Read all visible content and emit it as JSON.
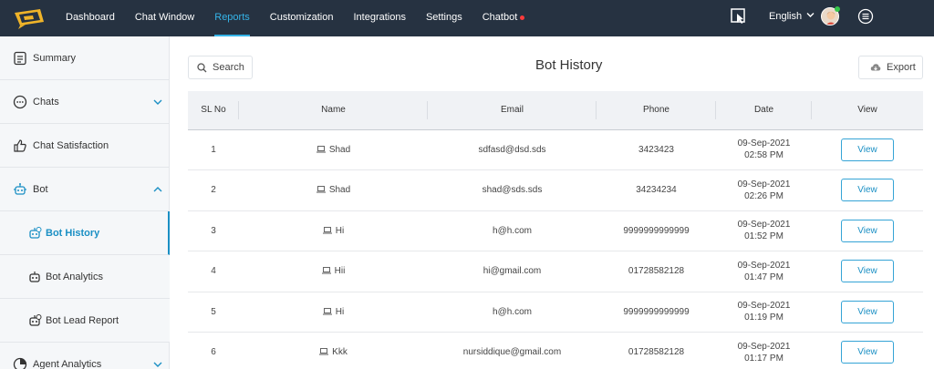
{
  "nav": {
    "items": [
      {
        "label": "Dashboard",
        "name": "nav-dashboard"
      },
      {
        "label": "Chat Window",
        "name": "nav-chat-window"
      },
      {
        "label": "Reports",
        "name": "nav-reports"
      },
      {
        "label": "Customization",
        "name": "nav-customization"
      },
      {
        "label": "Integrations",
        "name": "nav-integrations"
      },
      {
        "label": "Settings",
        "name": "nav-settings"
      },
      {
        "label": "Chatbot",
        "name": "nav-chatbot"
      }
    ],
    "active": "Reports",
    "language": "English",
    "accent_color": "#35b4e8",
    "bg_color": "#263241",
    "notification_dot_color": "#ff3b3b"
  },
  "sidebar": {
    "items": [
      {
        "label": "Summary",
        "icon": "document-icon"
      },
      {
        "label": "Chats",
        "icon": "chat-bubble-icon"
      },
      {
        "label": "Chat Satisfaction",
        "icon": "thumbs-up-icon"
      },
      {
        "label": "Bot",
        "icon": "bot-icon"
      },
      {
        "label": "Bot History",
        "icon": "bot-history-icon"
      },
      {
        "label": "Bot Analytics",
        "icon": "bot-analytics-icon"
      },
      {
        "label": "Bot Lead Report",
        "icon": "bot-lead-icon"
      },
      {
        "label": "Agent Analytics",
        "icon": "agent-analytics-icon"
      }
    ],
    "active": "Bot History"
  },
  "main": {
    "title": "Bot History",
    "search_label": "Search",
    "export_label": "Export",
    "columns": [
      "SL No",
      "Name",
      "Email",
      "Phone",
      "Date",
      "View"
    ],
    "rows": [
      {
        "sl": "1",
        "name": "Shad",
        "email": "sdfasd@dsd.sds",
        "phone": "3423423",
        "date": "09-Sep-2021",
        "time": "02:58 PM",
        "view": "View"
      },
      {
        "sl": "2",
        "name": "Shad",
        "email": "shad@sds.sds",
        "phone": "34234234",
        "date": "09-Sep-2021",
        "time": "02:26 PM",
        "view": "View"
      },
      {
        "sl": "3",
        "name": "Hi",
        "email": "h@h.com",
        "phone": "9999999999999",
        "date": "09-Sep-2021",
        "time": "01:52 PM",
        "view": "View"
      },
      {
        "sl": "4",
        "name": "Hii",
        "email": "hi@gmail.com",
        "phone": "01728582128",
        "date": "09-Sep-2021",
        "time": "01:47 PM",
        "view": "View"
      },
      {
        "sl": "5",
        "name": "Hi",
        "email": "h@h.com",
        "phone": "9999999999999",
        "date": "09-Sep-2021",
        "time": "01:19 PM",
        "view": "View"
      },
      {
        "sl": "6",
        "name": "Kkk",
        "email": "nursiddique@gmail.com",
        "phone": "01728582128",
        "date": "09-Sep-2021",
        "time": "01:17 PM",
        "view": "View"
      }
    ]
  }
}
